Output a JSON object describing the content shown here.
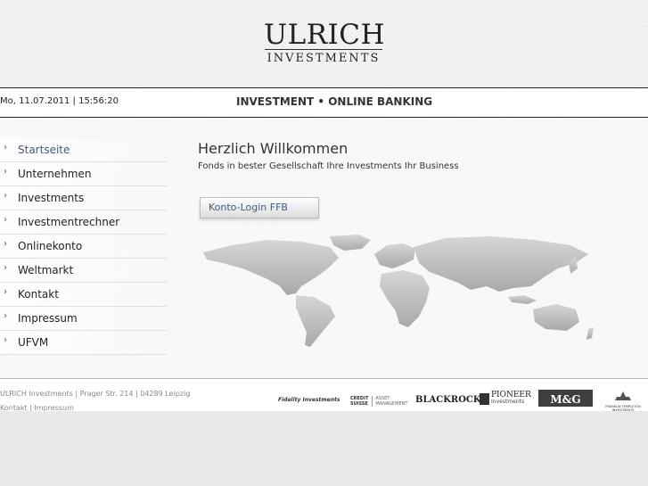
{
  "header": {
    "logo_main": "ULRICH",
    "logo_sub": "INVESTMENTS"
  },
  "infobar": {
    "datetime": "Mo, 11.07.2011 | 15:56:20",
    "claim": "INVESTMENT • ONLINE BANKING"
  },
  "nav": {
    "arrow": "›",
    "items": [
      {
        "label": "Startseite",
        "active": true
      },
      {
        "label": "Unternehmen"
      },
      {
        "label": "Investments"
      },
      {
        "label": "Investmentrechner"
      },
      {
        "label": "Onlinekonto"
      },
      {
        "label": "Weltmarkt"
      },
      {
        "label": "Kontakt"
      },
      {
        "label": "Impressum"
      },
      {
        "label": "UFVM"
      }
    ]
  },
  "main": {
    "title": "Herzlich Willkommen",
    "subtitle": "Fonds in bester Gesellschaft Ihre Investments Ihr Business",
    "login_button": "Konto-Login FFB"
  },
  "footer": {
    "address": "ULRICH Investments | Prager Str. 214 | 04289 Leipzig",
    "kontakt": "Kontakt",
    "separator": "|",
    "impressum": "Impressum"
  },
  "partners": {
    "fidelity": "Fidelity Investments",
    "cs_1": "CREDIT",
    "cs_2": "SUISSE",
    "cs_3": "ASSET",
    "cs_4": "MANAGEMENT",
    "blackrock": "BLACKROCK",
    "pioneer_1": "PIONEER",
    "pioneer_2": "Investments",
    "mg": "M&G",
    "franklin_1": "FRANKLIN TEMPLETON",
    "franklin_2": "INVESTMENTS"
  },
  "colors": {
    "link_blue": "#3c5c88",
    "header_rule": "#222222",
    "map_gray": "#b5b5b5"
  }
}
